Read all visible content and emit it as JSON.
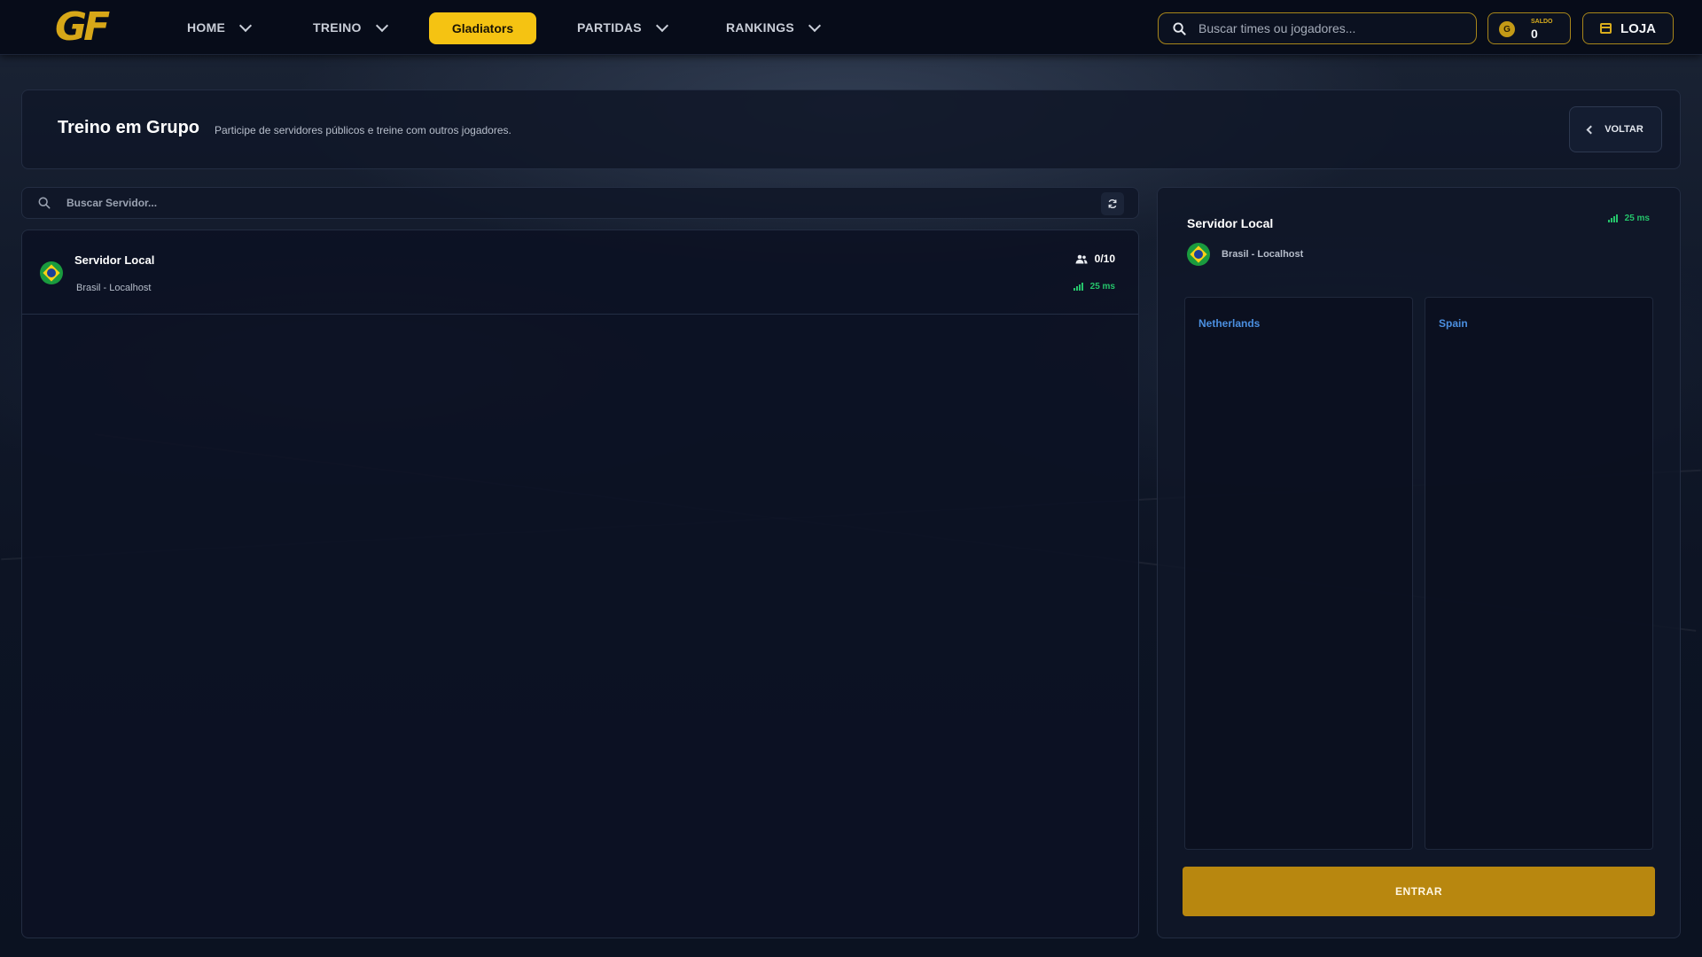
{
  "topbar": {
    "logo": "GF",
    "nav": [
      {
        "label": "HOME"
      },
      {
        "label": "TREINO"
      },
      {
        "label": "Gladiators"
      },
      {
        "label": "PARTIDAS"
      },
      {
        "label": "RANKINGS"
      }
    ],
    "search_placeholder": "Buscar times ou jogadores...",
    "saldo": {
      "label": "SALDO",
      "value": "0",
      "coin_letter": "G"
    },
    "store_label": "LOJA"
  },
  "header": {
    "title": "Treino em Grupo",
    "subtitle": "Participe de servidores públicos e treine com outros jogadores.",
    "back_label": "VOLTAR"
  },
  "server_search": {
    "placeholder": "Buscar Servidor..."
  },
  "servers": [
    {
      "name": "Servidor Local",
      "location": "Brasil - Localhost",
      "players": "0/10",
      "ping": "25 ms"
    }
  ],
  "selected_server": {
    "name": "Servidor Local",
    "location": "Brasil - Localhost",
    "ping": "25 ms",
    "teams": [
      {
        "name": "Netherlands"
      },
      {
        "name": "Spain"
      }
    ],
    "join_label": "ENTRAR"
  },
  "colors": {
    "accent": "#f5c312",
    "join_button": "#b8870f",
    "ping_green": "#25c46b",
    "team_blue": "#4b8fe0"
  }
}
